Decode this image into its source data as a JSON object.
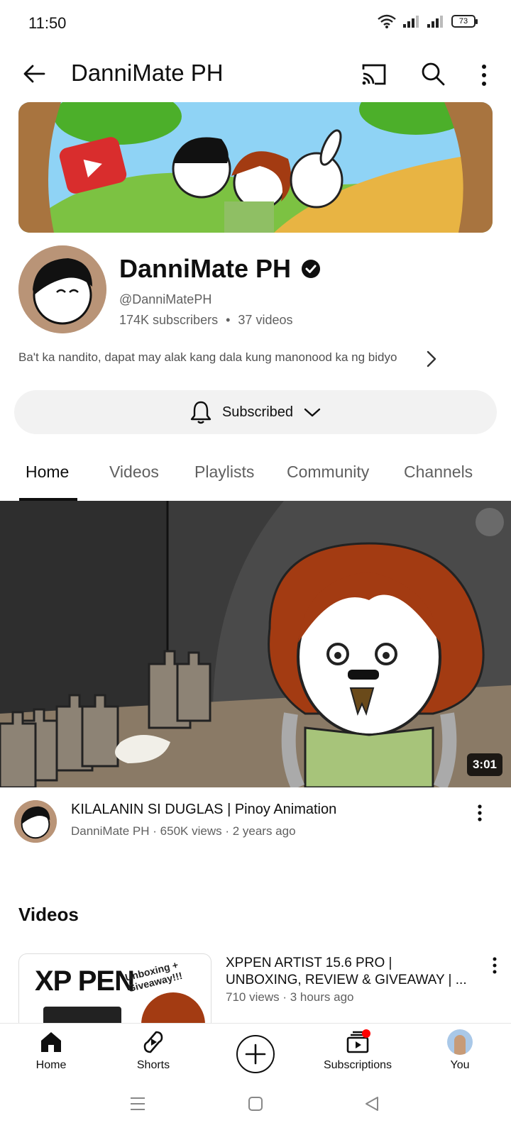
{
  "status_bar": {
    "time": "11:50",
    "battery": "73"
  },
  "app_bar": {
    "title": "DanniMate PH"
  },
  "channel": {
    "name": "DanniMate PH",
    "handle": "@DanniMatePH",
    "subscribers": "174K subscribers",
    "separator": "•",
    "videos": "37 videos",
    "description": "Ba't ka nandito, dapat may alak kang dala kung manonood ka ng bidyo"
  },
  "subscribe_button": {
    "label": "Subscribed"
  },
  "tabs": [
    {
      "label": "Home",
      "active": true
    },
    {
      "label": "Videos",
      "active": false
    },
    {
      "label": "Playlists",
      "active": false
    },
    {
      "label": "Community",
      "active": false
    },
    {
      "label": "Channels",
      "active": false
    }
  ],
  "featured_video": {
    "duration": "3:01",
    "title": "KILALANIN SI DUGLAS | Pinoy Animation",
    "meta": "DanniMate PH · 650K views · 2 years ago"
  },
  "videos_section": {
    "title": "Videos",
    "items": [
      {
        "title_line1": "XPPEN ARTIST 15.6 PRO |",
        "title_line2": "UNBOXING, REVIEW & GIVEAWAY | ...",
        "meta": "710 views · 3 hours ago",
        "thumb_text": "XP PEN",
        "thumb_sub": "Unboxing + Giveaway!!!"
      }
    ]
  },
  "bottom_nav": [
    {
      "label": "Home",
      "icon": "home-icon"
    },
    {
      "label": "Shorts",
      "icon": "shorts-icon"
    },
    {
      "label": "",
      "icon": "create-icon"
    },
    {
      "label": "Subscriptions",
      "icon": "subscriptions-icon"
    },
    {
      "label": "You",
      "icon": "profile-avatar"
    }
  ],
  "colors": {
    "accent_red": "#ff0000",
    "text_primary": "#0f0f0f",
    "text_secondary": "#606060",
    "chip_bg": "#f2f2f2"
  }
}
